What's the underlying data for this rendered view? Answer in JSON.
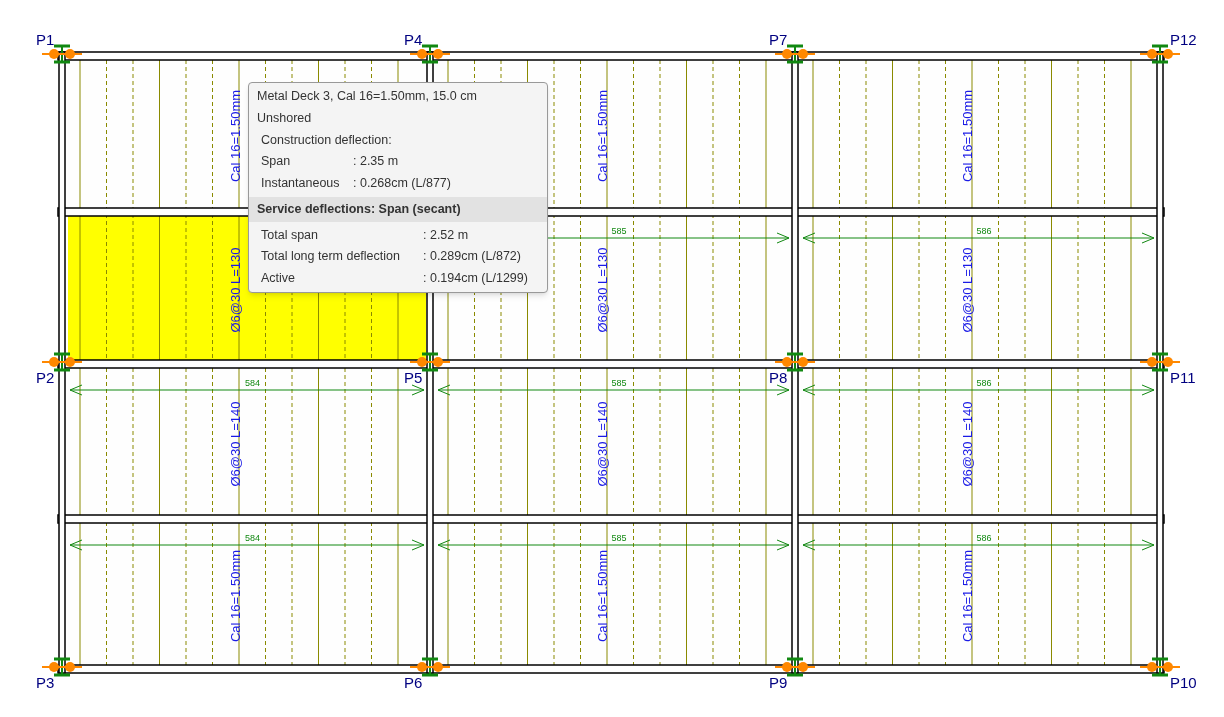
{
  "column_grid": [
    [
      "P1",
      "P4",
      "P7",
      "P12"
    ],
    [
      "P2",
      "P5",
      "P8",
      "P11"
    ],
    [
      "P3",
      "P6",
      "P9",
      "P10"
    ]
  ],
  "bays": [
    {
      "sub_panels": [
        {
          "selected": false,
          "note": "Cal 16=1.50mm"
        },
        {
          "selected": true,
          "note": "Ø6@30 L=130"
        },
        {
          "selected": false,
          "note": "Ø6@30 L=140",
          "dimension": "584"
        },
        {
          "selected": false,
          "note": "Cal 16=1.50mm",
          "dimension": "584"
        }
      ]
    },
    {
      "sub_panels": [
        {
          "selected": false,
          "note": "Cal 16=1.50mm"
        },
        {
          "selected": false,
          "note": "Ø6@30 L=130",
          "dimension": "585"
        },
        {
          "selected": false,
          "note": "Ø6@30 L=140",
          "dimension": "585"
        },
        {
          "selected": false,
          "note": "Cal 16=1.50mm",
          "dimension": "585"
        }
      ]
    },
    {
      "sub_panels": [
        {
          "selected": false,
          "note": "Cal 16=1.50mm"
        },
        {
          "selected": false,
          "note": "Ø6@30 L=130",
          "dimension": "586"
        },
        {
          "selected": false,
          "note": "Ø6@30 L=140",
          "dimension": "586"
        },
        {
          "selected": false,
          "note": "Cal 16=1.50mm",
          "dimension": "586"
        }
      ]
    }
  ],
  "tooltip": {
    "lines": [
      "Metal Deck 3, Cal 16=1.50mm, 15.0 cm",
      "Unshored"
    ],
    "subheading": "Construction deflection:",
    "rows": [
      {
        "label": "Span",
        "value": ": 2.35 m"
      },
      {
        "label": "Instantaneous",
        "value": ": 0.268cm (L/877)"
      }
    ],
    "section_title": "Service deflections: Span (secant)",
    "section_rows": [
      {
        "label": "Total span",
        "value": ": 2.52 m"
      },
      {
        "label": "Total long term deflection",
        "value": ": 0.289cm (L/872)"
      },
      {
        "label": "Active",
        "value": ": 0.194cm (L/1299)"
      }
    ]
  }
}
